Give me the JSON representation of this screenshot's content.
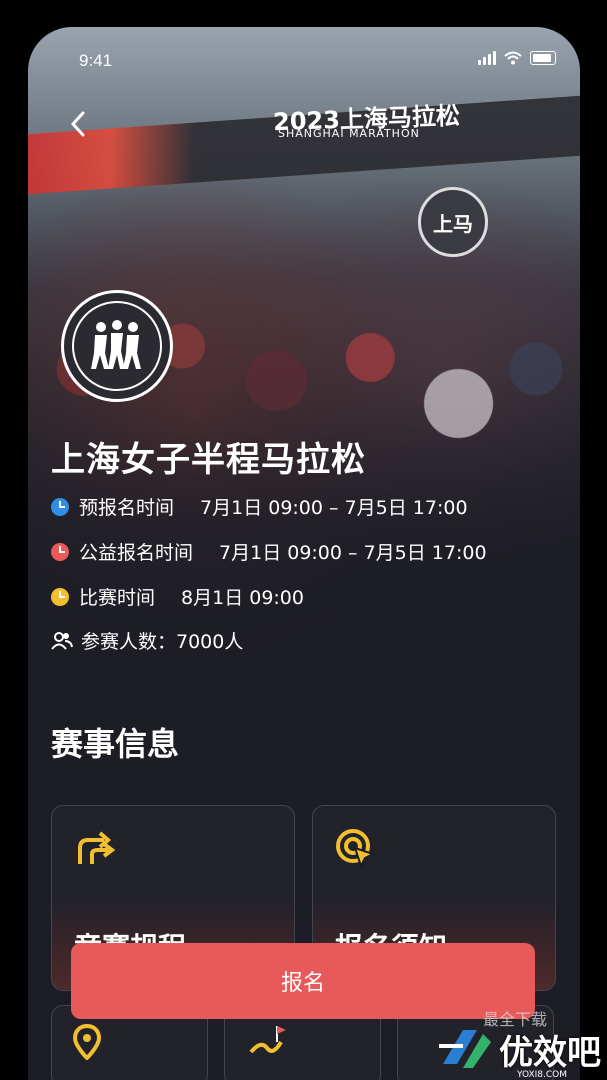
{
  "status_bar": {
    "time": "9:41"
  },
  "hero": {
    "arch_text": "2023上海马拉松",
    "arch_sub": "SHANGHAI MARATHON",
    "sign": "上马"
  },
  "event": {
    "title": "上海女子半程马拉松",
    "rows": [
      {
        "label": "预报名时间",
        "value": "7月1日 09:00 – 7月5日 17:00",
        "color": "#2f8fe8"
      },
      {
        "label": "公益报名时间",
        "value": "7月1日 09:00 – 7月5日 17:00",
        "color": "#e85a5a"
      },
      {
        "label": "比赛时间",
        "value": "8月1日 09:00",
        "color": "#f2c02e"
      }
    ],
    "participants": "参赛人数：7000人"
  },
  "section": {
    "title": "赛事信息"
  },
  "cards": [
    {
      "label": "竞赛规程",
      "icon": "route-split-icon"
    },
    {
      "label": "报名须知",
      "icon": "target-pointer-icon"
    }
  ],
  "cards_row2": [
    {
      "icon": "location-pin-icon"
    },
    {
      "icon": "route-flag-icon"
    }
  ],
  "register_button": "报名",
  "watermark": {
    "top": "最全下载",
    "brand": "优效吧",
    "domain": "YOXI8.COM"
  },
  "colors": {
    "accent": "#e85a5a",
    "icon_yellow": "#f2c02e",
    "bg": "#1d1d26"
  }
}
